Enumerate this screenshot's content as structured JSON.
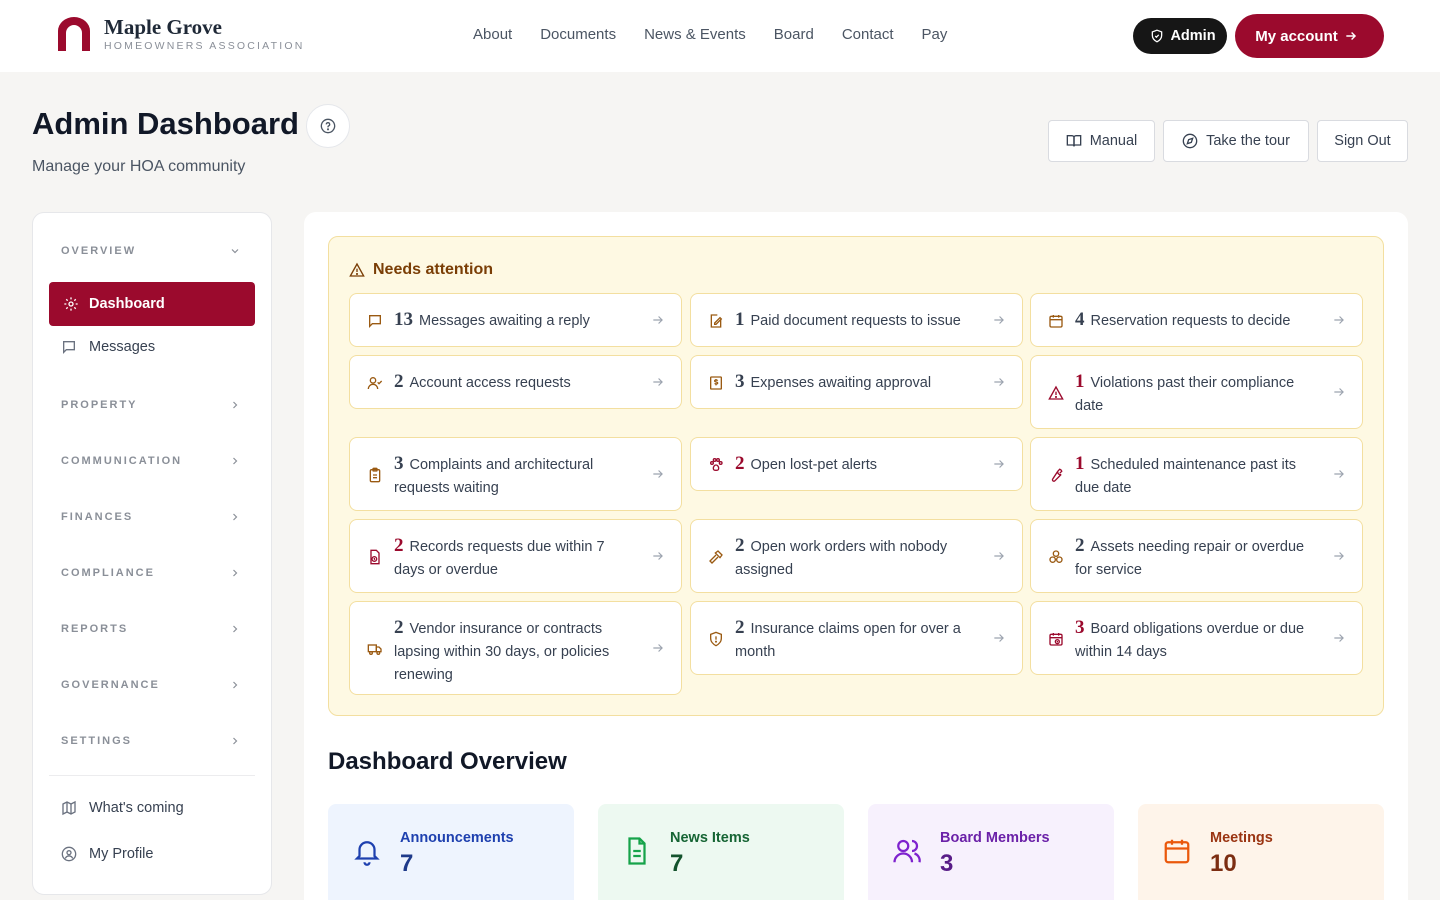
{
  "brand": {
    "name": "Maple Grove",
    "subtitle": "HOMEOWNERS ASSOCIATION",
    "color": "#9b0a2d"
  },
  "nav": [
    "About",
    "Documents",
    "News & Events",
    "Board",
    "Contact",
    "Pay"
  ],
  "top_buttons": {
    "admin": "Admin",
    "account": "My account"
  },
  "header": {
    "title": "Admin Dashboard",
    "subtitle": "Manage your HOA community",
    "manual": "Manual",
    "tour": "Take the tour",
    "signout": "Sign Out"
  },
  "sidebar": {
    "overview": "OVERVIEW",
    "active": "Dashboard",
    "messages": "Messages",
    "sections": [
      "PROPERTY",
      "COMMUNICATION",
      "FINANCES",
      "COMPLIANCE",
      "REPORTS",
      "GOVERNANCE",
      "SETTINGS"
    ],
    "whats_coming": "What's coming",
    "profile": "My Profile"
  },
  "attention": {
    "title": "Needs attention",
    "items": [
      {
        "count": "13",
        "text": "Messages awaiting a reply",
        "icon": "message-icon"
      },
      {
        "count": "1",
        "text": "Paid document requests to issue",
        "icon": "document-edit-icon"
      },
      {
        "count": "4",
        "text": "Reservation requests to decide",
        "icon": "calendar-icon"
      },
      {
        "count": "2",
        "text": "Account access requests",
        "icon": "user-check-icon"
      },
      {
        "count": "3",
        "text": "Expenses awaiting approval",
        "icon": "receipt-icon"
      },
      {
        "count": "1",
        "text": "Violations past their compliance date",
        "icon": "warning-icon"
      },
      {
        "count": "3",
        "text": "Complaints and architectural requests waiting",
        "icon": "clipboard-icon"
      },
      {
        "count": "2",
        "text": "Open lost-pet alerts",
        "icon": "paw-icon"
      },
      {
        "count": "1",
        "text": "Scheduled maintenance past its due date",
        "icon": "wrench-icon"
      },
      {
        "count": "2",
        "text": "Records requests due within 7 days or overdue",
        "icon": "file-clock-icon"
      },
      {
        "count": "2",
        "text": "Open work orders with nobody assigned",
        "icon": "hammer-icon"
      },
      {
        "count": "2",
        "text": "Assets needing repair or overdue for service",
        "icon": "boxes-icon"
      },
      {
        "count": "2",
        "text": "Vendor insurance or contracts lapsing within 30 days, or policies renewing",
        "icon": "truck-icon"
      },
      {
        "count": "2",
        "text": "Insurance claims open for over a month",
        "icon": "shield-icon"
      },
      {
        "count": "3",
        "text": "Board obligations overdue or due within 14 days",
        "icon": "calendar-clock-icon"
      }
    ]
  },
  "overview": {
    "title": "Dashboard Overview",
    "stats": [
      {
        "label": "Announcements",
        "value": "7",
        "color": "#1e40af",
        "bg": "#eef4fe"
      },
      {
        "label": "News Items",
        "value": "7",
        "color": "#166534",
        "bg": "#edf9f1"
      },
      {
        "label": "Board Members",
        "value": "3",
        "color": "#6b21a8",
        "bg": "#f7f1fd"
      },
      {
        "label": "Meetings",
        "value": "10",
        "color": "#9a3412",
        "bg": "#fef4ea"
      }
    ]
  }
}
